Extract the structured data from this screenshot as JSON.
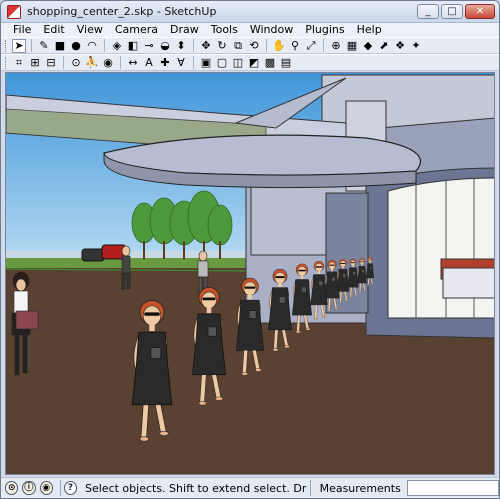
{
  "window": {
    "title": "shopping_center_2.skp - SketchUp",
    "controls": {
      "minimize": "_",
      "maximize": "□",
      "close": "✕"
    }
  },
  "menu": [
    "File",
    "Edit",
    "View",
    "Camera",
    "Draw",
    "Tools",
    "Window",
    "Plugins",
    "Help"
  ],
  "toolbar": {
    "row1": [
      {
        "name": "select-tool-icon",
        "glyph": "➤"
      },
      {
        "name": "pencil-line-tool-icon",
        "glyph": "✎"
      },
      {
        "name": "rectangle-tool-icon",
        "glyph": "■"
      },
      {
        "name": "circle-tool-icon",
        "glyph": "●"
      },
      {
        "name": "arc-tool-icon",
        "glyph": "◠"
      },
      {
        "name": "make-component-icon",
        "glyph": "◈"
      },
      {
        "name": "eraser-tool-icon",
        "glyph": "◧"
      },
      {
        "name": "tape-measure-icon",
        "glyph": "⊸"
      },
      {
        "name": "paint-bucket-icon",
        "glyph": "◒"
      },
      {
        "name": "push-pull-icon",
        "glyph": "⬍"
      },
      {
        "name": "move-tool-icon",
        "glyph": "✥"
      },
      {
        "name": "rotate-tool-icon",
        "glyph": "↻"
      },
      {
        "name": "offset-tool-icon",
        "glyph": "⧉"
      },
      {
        "name": "orbit-tool-icon",
        "glyph": "⟲"
      },
      {
        "name": "pan-tool-icon",
        "glyph": "✋"
      },
      {
        "name": "zoom-tool-icon",
        "glyph": "⚲"
      },
      {
        "name": "zoom-extents-icon",
        "glyph": "⤢"
      },
      {
        "name": "add-location-icon",
        "glyph": "⊕"
      },
      {
        "name": "toggle-terrain-icon",
        "glyph": "▦"
      },
      {
        "name": "get-models-icon",
        "glyph": "◆"
      },
      {
        "name": "share-model-icon",
        "glyph": "⬈"
      },
      {
        "name": "get-components-icon",
        "glyph": "❖"
      },
      {
        "name": "share-component-icon",
        "glyph": "✦"
      }
    ],
    "row2": [
      {
        "name": "section-plane-icon",
        "glyph": "⌗"
      },
      {
        "name": "section-display-icon",
        "glyph": "⊞"
      },
      {
        "name": "section-cuts-icon",
        "glyph": "⊟"
      },
      {
        "name": "position-camera-icon",
        "glyph": "⊙"
      },
      {
        "name": "walk-tool-icon",
        "glyph": "⛹"
      },
      {
        "name": "look-around-icon",
        "glyph": "◉"
      },
      {
        "name": "dimension-tool-icon",
        "glyph": "↔"
      },
      {
        "name": "text-tool-icon",
        "glyph": "A"
      },
      {
        "name": "axes-tool-icon",
        "glyph": "✚"
      },
      {
        "name": "3d-text-icon",
        "glyph": "Ɐ"
      },
      {
        "name": "xray-style-icon",
        "glyph": "▣"
      },
      {
        "name": "wireframe-style-icon",
        "glyph": "▢"
      },
      {
        "name": "hidden-line-style-icon",
        "glyph": "◫"
      },
      {
        "name": "shaded-style-icon",
        "glyph": "◩"
      },
      {
        "name": "shaded-textures-icon",
        "glyph": "▩"
      },
      {
        "name": "monochrome-style-icon",
        "glyph": "▤"
      }
    ]
  },
  "status": {
    "hint": "Select objects. Shift to extend select. Drag mo",
    "measurements_label": "Measurements",
    "measurements_value": "",
    "icons": [
      "geo-location-icon",
      "credits-icon",
      "user-icon",
      "help-icon"
    ],
    "help_glyph": "?"
  },
  "colors": {
    "sky": "#6fb1e3",
    "ground": "#5a4232",
    "building": "#b9bfd2",
    "dress": "#2a2a2a",
    "hair": "#c9522a"
  }
}
